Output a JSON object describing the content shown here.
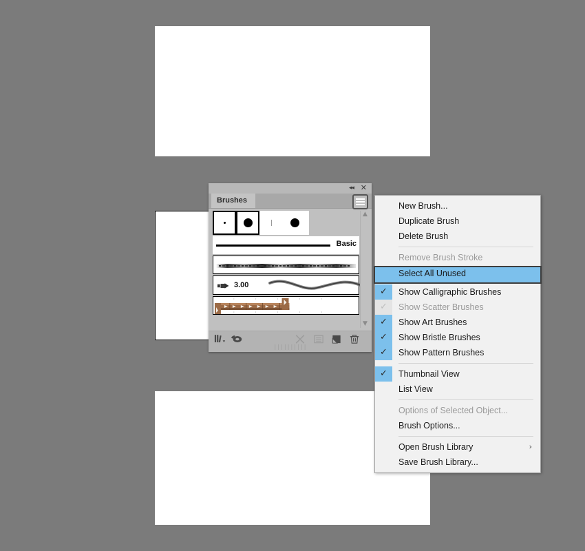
{
  "app": {
    "background_color": "#7b7b7b",
    "documents": [
      {
        "name": "document-canvas-top",
        "bordered": false
      },
      {
        "name": "document-canvas-middle",
        "bordered": true
      },
      {
        "name": "document-canvas-bottom",
        "bordered": false
      }
    ]
  },
  "panel": {
    "tab_label": "Brushes",
    "collapse_icon": "◂◂",
    "close_icon": "✕",
    "menu_button_icon": "hamburger-menu-icon",
    "scroll_up_icon": "▲",
    "scroll_down_icon": "▼",
    "thumbnails": [
      {
        "label": "basic-dot-small-brush",
        "selected": true,
        "glyph": "dot-tiny"
      },
      {
        "label": "basic-dot-large-brush",
        "selected": true,
        "glyph": "dot-big"
      },
      {
        "label": "calligraphic-thin-brush",
        "selected": false,
        "glyph": "dot-line"
      },
      {
        "label": "basic-round-brush",
        "selected": false,
        "glyph": "dot-big"
      }
    ],
    "brush_rows": [
      {
        "name": "basic-stroke-row",
        "label": "Basic"
      },
      {
        "name": "charcoal-art-brush-row",
        "label": ""
      },
      {
        "name": "bristle-brush-row",
        "label": "3.00"
      },
      {
        "name": "pattern-brush-row",
        "label": ""
      }
    ],
    "footer_icons": [
      {
        "name": "brush-libraries-menu-icon",
        "glyph": "library",
        "enabled": true
      },
      {
        "name": "libraries-panel-icon",
        "glyph": "libraries",
        "enabled": true
      },
      {
        "name": "remove-brush-stroke-icon",
        "glyph": "x",
        "enabled": false
      },
      {
        "name": "options-of-selected-object-icon",
        "glyph": "options",
        "enabled": false
      },
      {
        "name": "new-brush-icon",
        "glyph": "new",
        "enabled": true
      },
      {
        "name": "delete-brush-icon",
        "glyph": "trash",
        "enabled": true
      }
    ],
    "grip_glyph": "||||||||||"
  },
  "menu": {
    "highlight_color": "#7cc0ec",
    "items": [
      {
        "label": "New Brush...",
        "name": "menu-item-new-brush",
        "state": "normal",
        "check": "none"
      },
      {
        "label": "Duplicate Brush",
        "name": "menu-item-duplicate-brush",
        "state": "normal",
        "check": "none"
      },
      {
        "label": "Delete Brush",
        "name": "menu-item-delete-brush",
        "state": "normal",
        "check": "none"
      },
      {
        "separator": true
      },
      {
        "label": "Remove Brush Stroke",
        "name": "menu-item-remove-brush-stroke",
        "state": "disabled",
        "check": "none"
      },
      {
        "label": "Select All Unused",
        "name": "menu-item-select-all-unused",
        "state": "highlight",
        "check": "none"
      },
      {
        "label": "Show Calligraphic Brushes",
        "name": "menu-item-show-calligraphic-brushes",
        "state": "normal",
        "check": "on"
      },
      {
        "label": "Show Scatter Brushes",
        "name": "menu-item-show-scatter-brushes",
        "state": "disabled",
        "check": "dim"
      },
      {
        "label": "Show Art Brushes",
        "name": "menu-item-show-art-brushes",
        "state": "normal",
        "check": "on"
      },
      {
        "label": "Show Bristle Brushes",
        "name": "menu-item-show-bristle-brushes",
        "state": "normal",
        "check": "on"
      },
      {
        "label": "Show Pattern Brushes",
        "name": "menu-item-show-pattern-brushes",
        "state": "normal",
        "check": "on"
      },
      {
        "separator": true
      },
      {
        "label": "Thumbnail View",
        "name": "menu-item-thumbnail-view",
        "state": "normal",
        "check": "on"
      },
      {
        "label": "List View",
        "name": "menu-item-list-view",
        "state": "normal",
        "check": "none"
      },
      {
        "separator": true
      },
      {
        "label": "Options of Selected Object...",
        "name": "menu-item-options-of-selected-object",
        "state": "disabled",
        "check": "none"
      },
      {
        "label": "Brush Options...",
        "name": "menu-item-brush-options",
        "state": "normal",
        "check": "none"
      },
      {
        "separator": true
      },
      {
        "label": "Open Brush Library",
        "name": "menu-item-open-brush-library",
        "state": "normal",
        "check": "none",
        "submenu": "›"
      },
      {
        "label": "Save Brush Library...",
        "name": "menu-item-save-brush-library",
        "state": "normal",
        "check": "none"
      }
    ]
  }
}
